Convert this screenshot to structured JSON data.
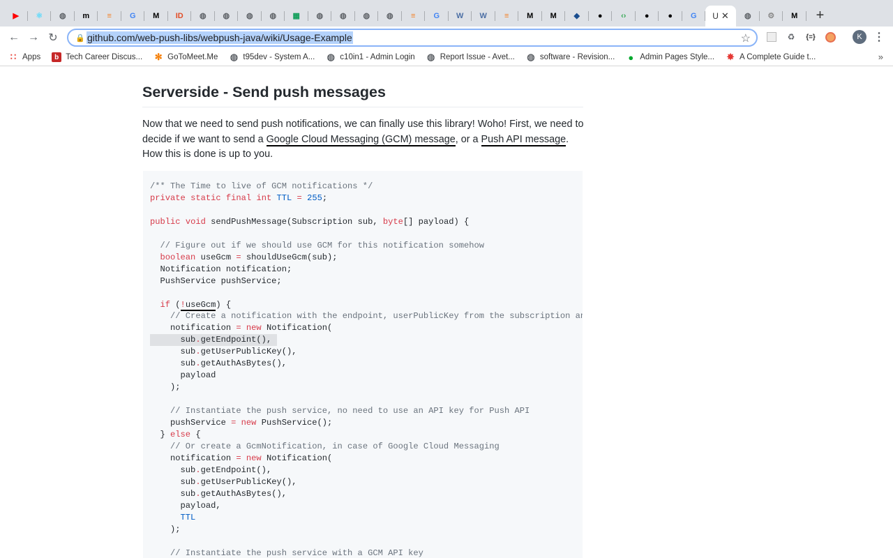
{
  "browser": {
    "tabs": [
      {
        "icon": "youtube-icon",
        "color": "#ff0000"
      },
      {
        "icon": "react-icon",
        "color": "#61dafb"
      },
      {
        "icon": "globe-icon",
        "color": "#5f6368"
      },
      {
        "icon": "medium-m-icon",
        "color": "#000000"
      },
      {
        "icon": "stackoverflow-icon",
        "color": "#f48024"
      },
      {
        "icon": "google-icon",
        "color": "#4285f4"
      },
      {
        "icon": "medium-icon",
        "color": "#000000"
      },
      {
        "icon": "html-icon",
        "color": "#e34c26"
      },
      {
        "icon": "globe-icon",
        "color": "#5f6368"
      },
      {
        "icon": "globe-icon",
        "color": "#5f6368"
      },
      {
        "icon": "globe-icon",
        "color": "#5f6368"
      },
      {
        "icon": "globe-icon",
        "color": "#5f6368"
      },
      {
        "icon": "sheets-icon",
        "color": "#0f9d58"
      },
      {
        "icon": "globe-icon",
        "color": "#5f6368"
      },
      {
        "icon": "globe-icon",
        "color": "#5f6368"
      },
      {
        "icon": "globe-icon",
        "color": "#5f6368"
      },
      {
        "icon": "globe-icon",
        "color": "#5f6368"
      },
      {
        "icon": "stackoverflow-icon",
        "color": "#f48024"
      },
      {
        "icon": "google-icon",
        "color": "#4285f4"
      },
      {
        "icon": "w3schools-icon",
        "color": "#4c6fa5"
      },
      {
        "icon": "w3schools-icon",
        "color": "#4c6fa5"
      },
      {
        "icon": "stackoverflow-icon",
        "color": "#f48024"
      },
      {
        "icon": "medium-icon",
        "color": "#000000"
      },
      {
        "icon": "medium-icon",
        "color": "#000000"
      },
      {
        "icon": "graduation-cap-icon",
        "color": "#1a4d8f"
      },
      {
        "icon": "github-icon",
        "color": "#000000"
      },
      {
        "icon": "code-icon",
        "color": "#34a853"
      },
      {
        "icon": "github-icon",
        "color": "#000000"
      },
      {
        "icon": "github-icon",
        "color": "#000000"
      },
      {
        "icon": "google-icon",
        "color": "#4285f4"
      }
    ],
    "active_tab_title": "U",
    "trailing_tabs": [
      {
        "icon": "globe-icon",
        "color": "#5f6368"
      },
      {
        "icon": "gear-globe-icon",
        "color": "#8a8a8a"
      },
      {
        "icon": "medium-icon",
        "color": "#000000"
      }
    ],
    "url": "github.com/web-push-libs/webpush-java/wiki/Usage-Example",
    "avatar_letter": "K",
    "bookmarks": [
      {
        "label": "Apps",
        "icon": "apps-grid-icon",
        "color": "#e8453c"
      },
      {
        "label": "Tech Career Discus...",
        "icon": "blind-b-icon",
        "color": "#c62828"
      },
      {
        "label": "GoToMeet.Me",
        "icon": "asterisk-icon",
        "color": "#f57c00"
      },
      {
        "label": "t95dev - System A...",
        "icon": "globe-icon",
        "color": "#5f6368"
      },
      {
        "label": "c10in1 - Admin Login",
        "icon": "globe-icon",
        "color": "#5f6368"
      },
      {
        "label": "Report Issue - Avet...",
        "icon": "globe-icon",
        "color": "#5f6368"
      },
      {
        "label": "software - Revision...",
        "icon": "globe-icon",
        "color": "#5f6368"
      },
      {
        "label": "Admin Pages Style...",
        "icon": "evernote-icon",
        "color": "#00a82d"
      },
      {
        "label": "A Complete Guide t...",
        "icon": "wheel-icon",
        "color": "#e53935"
      }
    ],
    "bookmarks_more": "»"
  },
  "page": {
    "heading": "Serverside - Send push messages",
    "para_1": "Now that we need to send push notifications, we can finally use this library! Woho! First, we need to decide if we want to send a ",
    "link_gcm": "Google Cloud Messaging (GCM) message",
    "para_2": ", or a ",
    "link_push": "Push API message",
    "para_3": ". How this is done is up to you."
  },
  "code_lines": [
    "/** The Time to live of GCM notifications */",
    "private static final int TTL = 255;",
    "",
    "public void sendPushMessage(Subscription sub, byte[] payload) {",
    "",
    "  // Figure out if we should use GCM for this notification somehow",
    "  boolean useGcm = shouldUseGcm(sub);",
    "  Notification notification;",
    "  PushService pushService;",
    "",
    "  if (!useGcm) {",
    "    // Create a notification with the endpoint, userPublicKey from the subscription an",
    "    notification = new Notification(",
    "      sub.getEndpoint(),",
    "      sub.getUserPublicKey(),",
    "      sub.getAuthAsBytes(),",
    "      payload",
    "    );",
    "",
    "    // Instantiate the push service, no need to use an API key for Push API",
    "    pushService = new PushService();",
    "  } else {",
    "    // Or create a GcmNotification, in case of Google Cloud Messaging",
    "    notification = new Notification(",
    "      sub.getEndpoint(),",
    "      sub.getUserPublicKey(),",
    "      sub.getAuthAsBytes(),",
    "      payload,",
    "      TTL",
    "    );",
    "",
    "    // Instantiate the push service with a GCM API key"
  ]
}
